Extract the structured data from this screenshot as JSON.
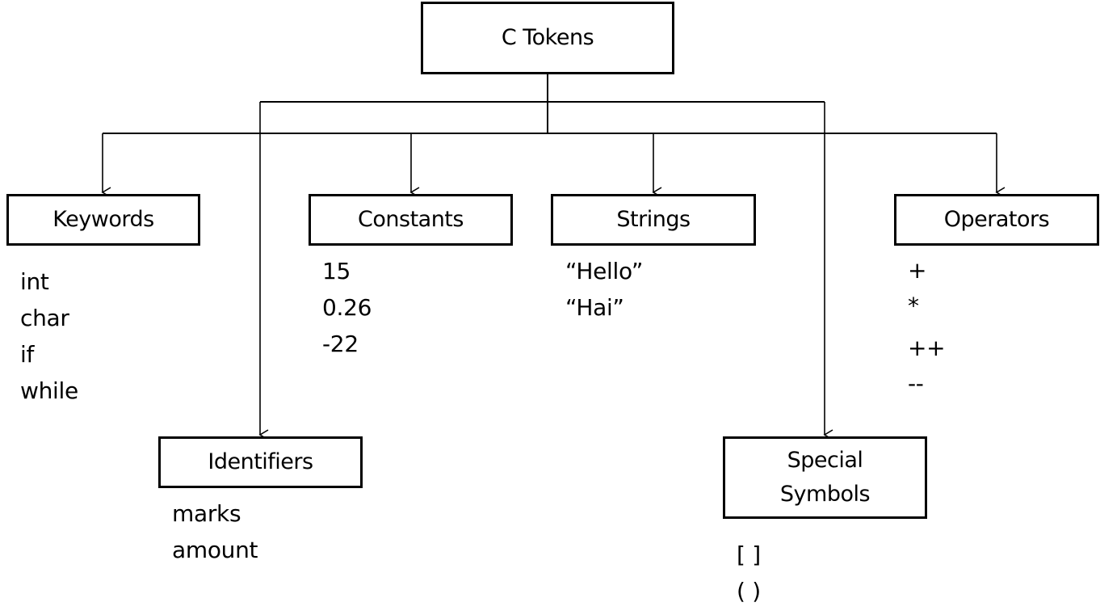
{
  "diagram": {
    "root": {
      "label": "C Tokens"
    },
    "categories": [
      {
        "id": "keywords",
        "label": "Keywords",
        "label_lines": [
          "Keywords"
        ],
        "examples": [
          "int",
          "char",
          "if",
          "while"
        ]
      },
      {
        "id": "identifiers",
        "label": "Identifiers",
        "label_lines": [
          "Identifiers"
        ],
        "examples": [
          "marks",
          "amount"
        ]
      },
      {
        "id": "constants",
        "label": "Constants",
        "label_lines": [
          "Constants"
        ],
        "examples": [
          "15",
          "0.26",
          "-22"
        ]
      },
      {
        "id": "strings",
        "label": "Strings",
        "label_lines": [
          "Strings"
        ],
        "examples": [
          "“Hello”",
          "“Hai”"
        ]
      },
      {
        "id": "special-symbols",
        "label": "Special Symbols",
        "label_lines": [
          "Special",
          "Symbols"
        ],
        "examples": [
          "[ ]",
          "( )"
        ]
      },
      {
        "id": "operators",
        "label": "Operators",
        "label_lines": [
          "Operators"
        ],
        "examples": [
          "+",
          "*",
          "++",
          "--"
        ]
      }
    ],
    "colors": {
      "stroke": "#000000",
      "background": "#ffffff",
      "text": "#000000"
    }
  }
}
